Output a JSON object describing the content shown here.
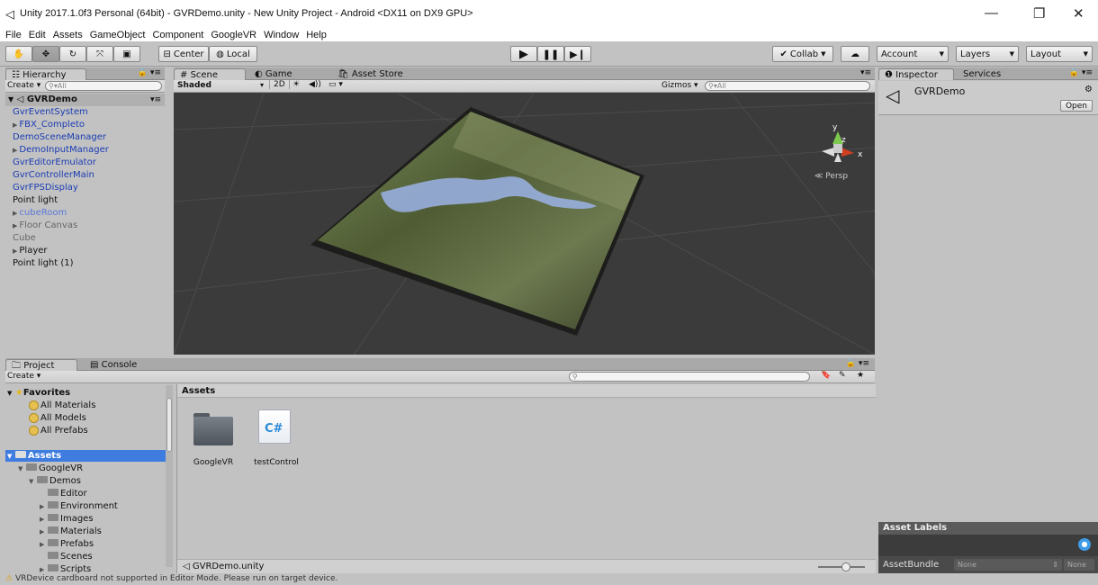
{
  "window": {
    "title": "Unity 2017.1.0f3 Personal (64bit) - GVRDemo.unity - New Unity Project - Android <DX11 on DX9 GPU>",
    "minimize": "—",
    "maximize": "❐",
    "close": "✕"
  },
  "menu": [
    "File",
    "Edit",
    "Assets",
    "GameObject",
    "Component",
    "GoogleVR",
    "Window",
    "Help"
  ],
  "toolbar": {
    "pivot": "Center",
    "space": "Local",
    "collab": "Collab",
    "account": "Account",
    "layers": "Layers",
    "layout": "Layout"
  },
  "hierarchy": {
    "tab": "Hierarchy",
    "create": "Create",
    "search_placeholder": "All",
    "scene": "GVRDemo",
    "items": [
      {
        "label": "GvrEventSystem",
        "color": "blue",
        "arrow": false
      },
      {
        "label": "FBX_Completo",
        "color": "blue",
        "arrow": true
      },
      {
        "label": "DemoSceneManager",
        "color": "blue",
        "arrow": false
      },
      {
        "label": "DemoInputManager",
        "color": "blue",
        "arrow": true
      },
      {
        "label": "GvrEditorEmulator",
        "color": "blue",
        "arrow": false
      },
      {
        "label": "GvrControllerMain",
        "color": "blue",
        "arrow": false
      },
      {
        "label": "GvrFPSDisplay",
        "color": "blue",
        "arrow": false
      },
      {
        "label": "Point light",
        "color": "black",
        "arrow": false
      },
      {
        "label": "cubeRoom",
        "color": "lightblue",
        "arrow": true
      },
      {
        "label": "Floor Canvas",
        "color": "gray",
        "arrow": true
      },
      {
        "label": "Cube",
        "color": "gray",
        "arrow": false
      },
      {
        "label": "Player",
        "color": "black",
        "arrow": true
      },
      {
        "label": "Point light (1)",
        "color": "black",
        "arrow": false
      }
    ]
  },
  "scene_view": {
    "tabs": [
      "Scene",
      "Game",
      "Asset Store"
    ],
    "shading": "Shaded",
    "mode_2d": "2D",
    "gizmos": "Gizmos",
    "search_placeholder": "All",
    "persp": "Persp",
    "axis_y": "y",
    "axis_x": "x",
    "axis_z": "z"
  },
  "inspector": {
    "tabs": [
      "Inspector",
      "Services"
    ],
    "object": "GVRDemo",
    "open": "Open",
    "asset_labels": "Asset Labels",
    "asset_bundle": "AssetBundle",
    "bundle_value": "None",
    "bundle_variant": "None"
  },
  "project": {
    "tabs": [
      "Project",
      "Console"
    ],
    "create": "Create",
    "favorites": "Favorites",
    "favorite_items": [
      "All Materials",
      "All Models",
      "All Prefabs"
    ],
    "assets_root": "Assets",
    "tree": [
      {
        "label": "GoogleVR",
        "indent": 1,
        "arrow": "down"
      },
      {
        "label": "Demos",
        "indent": 2,
        "arrow": "down"
      },
      {
        "label": "Editor",
        "indent": 3,
        "arrow": ""
      },
      {
        "label": "Environment",
        "indent": 3,
        "arrow": "right"
      },
      {
        "label": "Images",
        "indent": 3,
        "arrow": "right"
      },
      {
        "label": "Materials",
        "indent": 3,
        "arrow": "right"
      },
      {
        "label": "Prefabs",
        "indent": 3,
        "arrow": "right"
      },
      {
        "label": "Scenes",
        "indent": 3,
        "arrow": ""
      },
      {
        "label": "Scripts",
        "indent": 3,
        "arrow": "right"
      }
    ],
    "breadcrumb": "Assets",
    "assets": [
      {
        "label": "GoogleVR",
        "type": "folder"
      },
      {
        "label": "testControl",
        "type": "csharp"
      }
    ],
    "csharp_glyph": "C#",
    "selected_path": "GVRDemo.unity"
  },
  "status": {
    "message": "VRDevice cardboard not supported in Editor Mode.  Please run on target device."
  }
}
